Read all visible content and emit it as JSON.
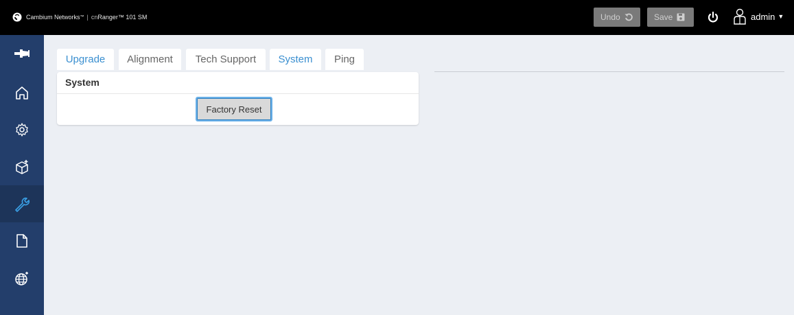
{
  "topbar": {
    "brand_name": "Cambium Networks",
    "brand_tm": "™",
    "separator": "|",
    "product_prefix": "cn",
    "product_name": "Ranger™ 101 SM",
    "undo_label": "Undo",
    "save_label": "Save",
    "user_label": "admin"
  },
  "sidebar": {
    "items": [
      {
        "icon": "pin-icon",
        "active": false
      },
      {
        "icon": "home-icon",
        "active": false
      },
      {
        "icon": "gear-icon",
        "active": false
      },
      {
        "icon": "box-icon",
        "active": false
      },
      {
        "icon": "wrench-icon",
        "active": true
      },
      {
        "icon": "file-icon",
        "active": false
      },
      {
        "icon": "globe-icon",
        "active": false
      }
    ]
  },
  "tabs": [
    {
      "label": "Upgrade"
    },
    {
      "label": "Alignment"
    },
    {
      "label": "Tech Support"
    },
    {
      "label": "System"
    },
    {
      "label": "Ping"
    }
  ],
  "panel": {
    "title": "System",
    "factory_reset_label": "Factory Reset"
  },
  "colors": {
    "topbar": "#000000",
    "sidebar": "#233e6b",
    "sidebar_active": "#1d3459",
    "tab_active_text": "#3a8fd0",
    "page_bg": "#eceff4"
  }
}
